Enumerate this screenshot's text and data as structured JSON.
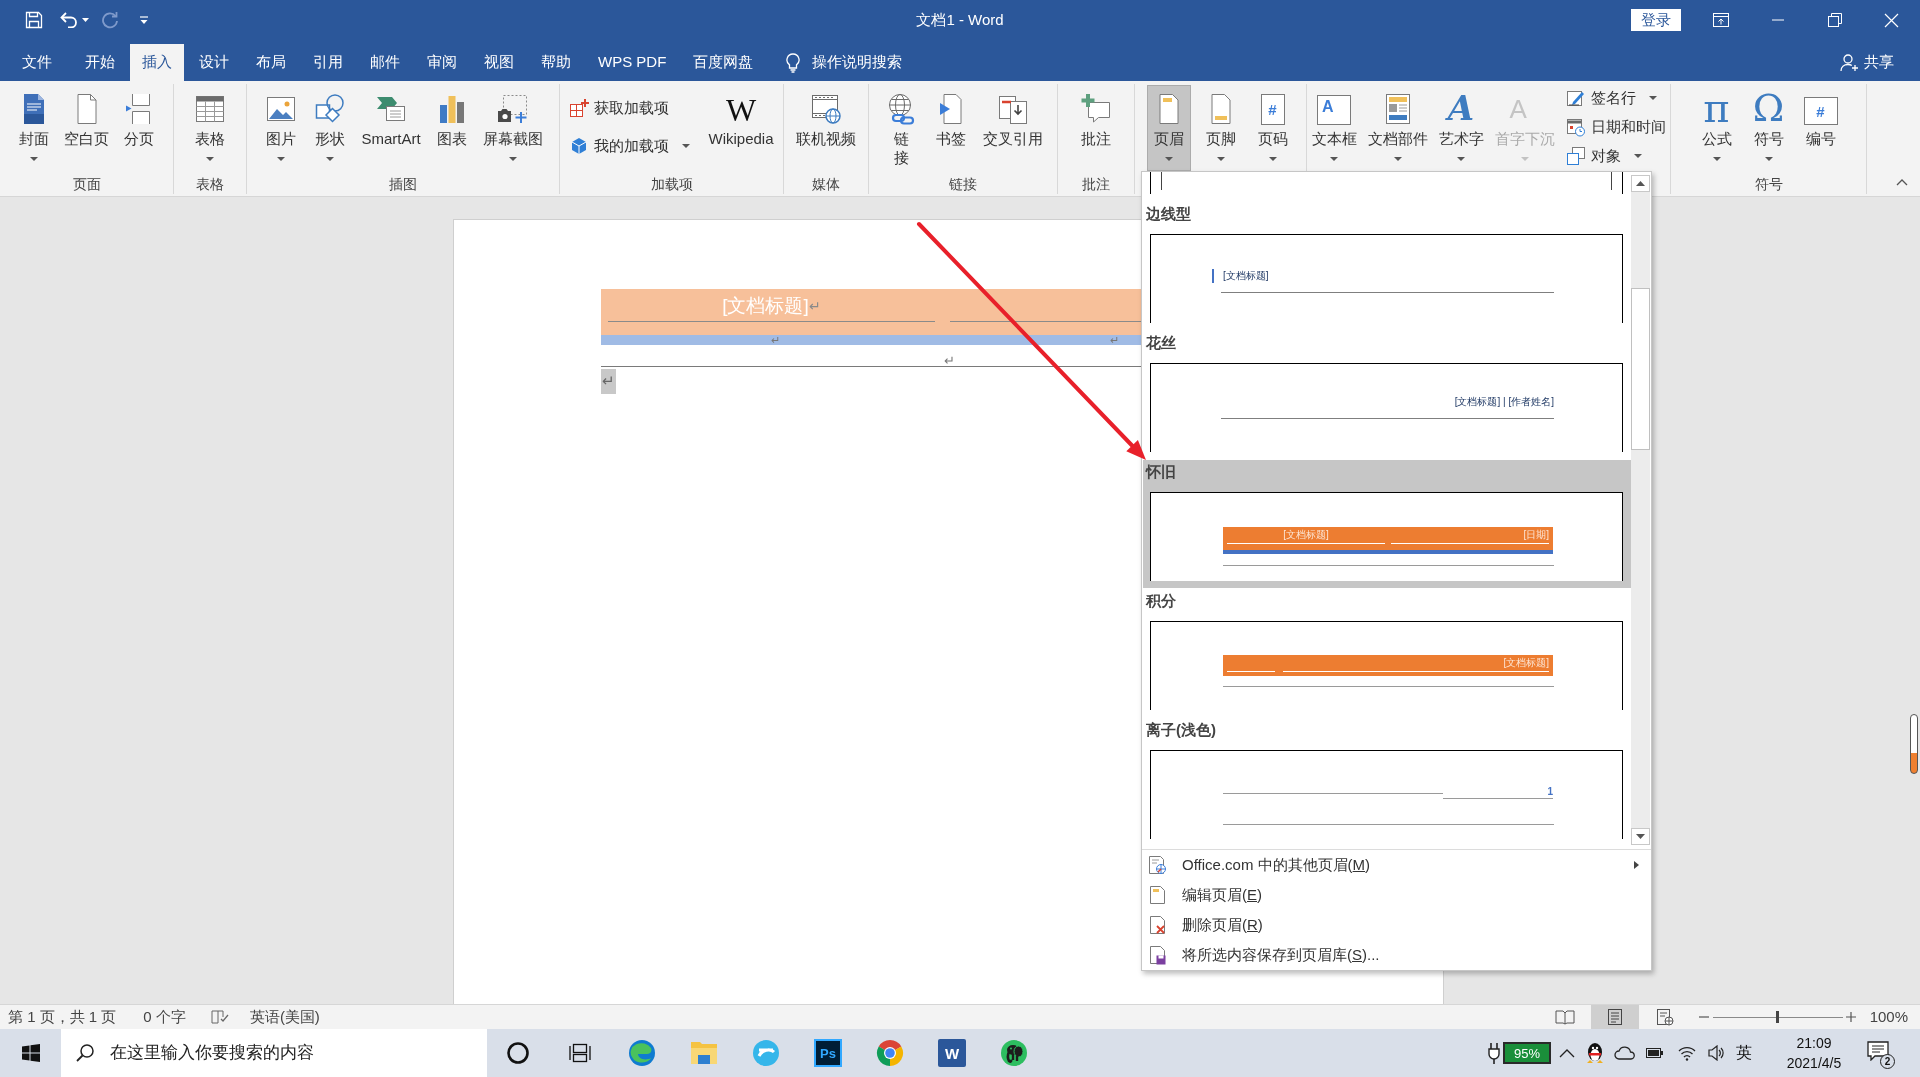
{
  "window": {
    "title": "文档1 - Word",
    "sign_in": "登录"
  },
  "quick_access": [
    {
      "kind": "save",
      "disabled": false,
      "menu": false
    },
    {
      "kind": "undo",
      "disabled": false,
      "menu": true
    },
    {
      "kind": "redo",
      "disabled": true,
      "menu": false
    },
    {
      "kind": "customize",
      "disabled": false,
      "menu": false
    }
  ],
  "tabs": [
    {
      "label": "文件",
      "selected": false
    },
    {
      "label": "开始",
      "selected": false
    },
    {
      "label": "插入",
      "selected": true
    },
    {
      "label": "设计",
      "selected": false
    },
    {
      "label": "布局",
      "selected": false
    },
    {
      "label": "引用",
      "selected": false
    },
    {
      "label": "邮件",
      "selected": false
    },
    {
      "label": "审阅",
      "selected": false
    },
    {
      "label": "视图",
      "selected": false
    },
    {
      "label": "帮助",
      "selected": false
    },
    {
      "label": "WPS PDF",
      "selected": false
    },
    {
      "label": "百度网盘",
      "selected": false
    }
  ],
  "tell_me": "操作说明搜索",
  "share": "共享",
  "ribbon": {
    "groups": [
      {
        "label": "页面",
        "items": [
          {
            "kind": "cover",
            "label": "封面",
            "menu": true,
            "pressed": false,
            "disabled": false
          },
          {
            "kind": "blankpage",
            "label": "空白页",
            "menu": false,
            "pressed": false,
            "disabled": false
          },
          {
            "kind": "pagebreak",
            "label": "分页",
            "menu": false,
            "pressed": false,
            "disabled": false
          }
        ]
      },
      {
        "label": "表格",
        "items": [
          {
            "kind": "table",
            "label": "表格",
            "menu": true,
            "pressed": false,
            "disabled": false
          }
        ]
      },
      {
        "label": "插图",
        "items": [
          {
            "kind": "picture",
            "label": "图片",
            "menu": true,
            "pressed": false,
            "disabled": false
          },
          {
            "kind": "shapes",
            "label": "形状",
            "menu": true,
            "pressed": false,
            "disabled": false
          },
          {
            "kind": "smartart",
            "label": "SmartArt",
            "menu": false,
            "pressed": false,
            "disabled": false
          },
          {
            "kind": "chart",
            "label": "图表",
            "menu": false,
            "pressed": false,
            "disabled": false
          },
          {
            "kind": "screenshot",
            "label": "屏幕截图",
            "menu": true,
            "pressed": false,
            "disabled": false
          }
        ]
      },
      {
        "label": "加载项",
        "items": [
          {
            "stack": [
              {
                "kind": "getaddins",
                "label": "获取加载项",
                "menu": false,
                "pressed": false,
                "disabled": false
              },
              {
                "kind": "myaddins",
                "label": "我的加载项",
                "menu": true,
                "pressed": false,
                "disabled": false
              }
            ]
          },
          {
            "kind": "wikipedia",
            "label": "Wikipedia",
            "glyph": "W",
            "menu": false,
            "pressed": false,
            "disabled": false
          }
        ]
      },
      {
        "label": "媒体",
        "items": [
          {
            "kind": "video",
            "label": "联机视频",
            "menu": false,
            "pressed": false,
            "disabled": false
          }
        ]
      },
      {
        "label": "链接",
        "items": [
          {
            "kind": "link",
            "label": "链接",
            "menu": false,
            "pressed": false,
            "disabled": false
          },
          {
            "kind": "bookmark",
            "label": "书签",
            "menu": false,
            "pressed": false,
            "disabled": false
          },
          {
            "kind": "crossref",
            "label": "交叉引用",
            "menu": false,
            "pressed": false,
            "disabled": false
          }
        ]
      },
      {
        "label": "批注",
        "items": [
          {
            "kind": "comment",
            "label": "批注",
            "menu": false,
            "pressed": false,
            "disabled": false
          }
        ]
      },
      {
        "items": [
          {
            "kind": "header",
            "label": "页眉",
            "menu": true,
            "pressed": true,
            "disabled": false
          },
          {
            "kind": "footer",
            "label": "页脚",
            "menu": true,
            "pressed": false,
            "disabled": false
          },
          {
            "kind": "pagenumber",
            "label": "页码",
            "glyph": "#",
            "menu": true,
            "pressed": false,
            "disabled": false
          }
        ]
      },
      {
        "items": [
          {
            "kind": "textbox",
            "label": "文本框",
            "glyph": "A",
            "menu": true,
            "pressed": false,
            "disabled": false
          },
          {
            "kind": "quickparts",
            "label": "文档部件",
            "menu": true,
            "pressed": false,
            "disabled": false
          },
          {
            "kind": "wordart",
            "label": "艺术字",
            "glyph": "A",
            "menu": true,
            "pressed": false,
            "disabled": false
          },
          {
            "kind": "dropcap",
            "label": "首字下沉",
            "glyph": "A",
            "menu": true,
            "pressed": false,
            "disabled": true
          },
          {
            "stack": [
              {
                "kind": "signature",
                "label": "签名行",
                "menu": true,
                "pressed": false,
                "disabled": false
              },
              {
                "kind": "datetime",
                "label": "日期和时间",
                "menu": false,
                "pressed": false,
                "disabled": false
              },
              {
                "kind": "object",
                "label": "对象",
                "menu": true,
                "pressed": false,
                "disabled": false
              }
            ]
          }
        ]
      },
      {
        "label": "符号",
        "items": [
          {
            "kind": "equation",
            "label": "公式",
            "glyph": "π",
            "menu": true,
            "pressed": false,
            "disabled": false
          },
          {
            "kind": "symbol",
            "label": "符号",
            "glyph": "Ω",
            "menu": true,
            "pressed": false,
            "disabled": false
          },
          {
            "kind": "number",
            "label": "编号",
            "glyph": "#",
            "menu": false,
            "pressed": false,
            "disabled": false
          }
        ]
      }
    ]
  },
  "document": {
    "header": {
      "title": "[文档标题]",
      "title_mark": "↵",
      "stripe_marks": [
        "↵",
        "↵"
      ],
      "row_mark": "↵"
    },
    "body": {
      "mark": "↵",
      "selected": true
    }
  },
  "header_gallery": {
    "items": [
      {
        "kind": "partial",
        "selected": false
      },
      {
        "kind": "sideline",
        "name": "边线型",
        "selected": false,
        "texts": [
          "[文档标题]"
        ]
      },
      {
        "kind": "filigree",
        "name": "花丝",
        "selected": false,
        "texts": [
          "[文档标题] | [作者姓名]"
        ]
      },
      {
        "kind": "retro",
        "name": "怀旧",
        "selected": true,
        "texts": [
          "[文档标题]",
          "[日期]"
        ]
      },
      {
        "kind": "integral",
        "name": "积分",
        "selected": false,
        "texts": [
          "[文档标题]"
        ]
      },
      {
        "kind": "ion",
        "name": "离子(浅色)",
        "selected": false,
        "texts": [
          "1"
        ]
      }
    ],
    "menu": [
      {
        "kind": "office",
        "before": "Office.com 中的其他页眉(",
        "key": "M",
        "after": ")",
        "submenu": true
      },
      {
        "kind": "edit",
        "before": "编辑页眉(",
        "key": "E",
        "after": ")",
        "submenu": false
      },
      {
        "kind": "remove",
        "before": "删除页眉(",
        "key": "R",
        "after": ")",
        "submenu": false
      },
      {
        "kind": "save",
        "before": "将所选内容保存到页眉库(",
        "key": "S",
        "after": ")...",
        "submenu": false
      }
    ]
  },
  "status_bar": {
    "page": "第 1 页，共 1 页",
    "words": "0 个字",
    "language": "英语(美国)",
    "views": [
      {
        "kind": "read",
        "selected": false
      },
      {
        "kind": "print",
        "selected": true
      },
      {
        "kind": "web",
        "selected": false
      }
    ],
    "zoom": {
      "level": 0.5,
      "value": "100%"
    }
  },
  "taskbar": {
    "search": {
      "placeholder": "在这里输入你要搜索的内容"
    },
    "apps": [
      {
        "kind": "cortana"
      },
      {
        "kind": "taskview"
      },
      {
        "kind": "edge"
      },
      {
        "kind": "explorer"
      },
      {
        "kind": "ebrowser"
      },
      {
        "kind": "photoshop",
        "glyph": "Ps"
      },
      {
        "kind": "chrome"
      },
      {
        "kind": "word",
        "glyph": "W"
      },
      {
        "kind": "evernote"
      }
    ],
    "battery": "95%",
    "ime": "英",
    "time": "21:09",
    "date": "2021/4/5",
    "notifications": "2"
  }
}
